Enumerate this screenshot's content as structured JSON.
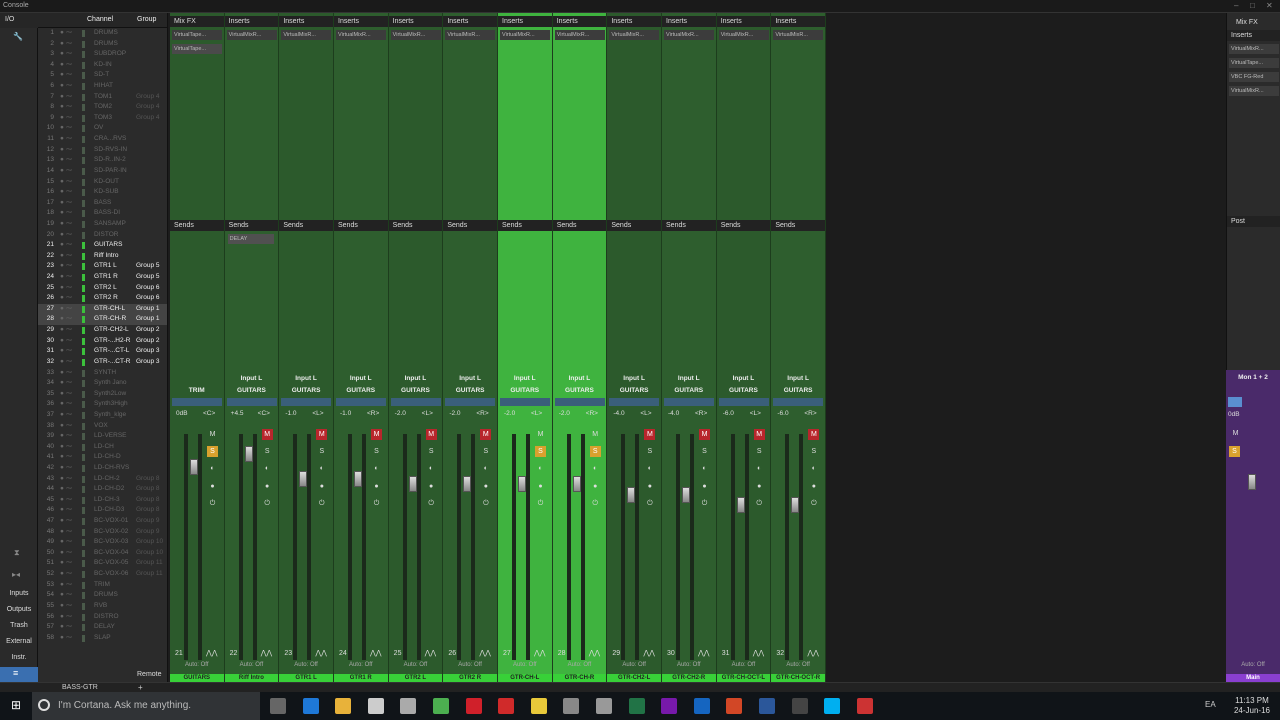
{
  "window": {
    "title": "Console"
  },
  "left_panel": {
    "io": "I/O",
    "items": [
      "Inputs",
      "Outputs",
      "Trash",
      "External",
      "Instr."
    ]
  },
  "channel_list": {
    "col_channel": "Channel",
    "col_group": "Group",
    "rows": [
      {
        "n": "1",
        "name": "DRUMS",
        "group": "",
        "active": false
      },
      {
        "n": "2",
        "name": "DRUMS",
        "group": "",
        "active": false
      },
      {
        "n": "3",
        "name": "SUBDROP",
        "group": "",
        "active": false
      },
      {
        "n": "4",
        "name": "KD-IN",
        "group": "",
        "active": false
      },
      {
        "n": "5",
        "name": "SD-T",
        "group": "",
        "active": false
      },
      {
        "n": "6",
        "name": "HIHAT",
        "group": "",
        "active": false
      },
      {
        "n": "7",
        "name": "TOM1",
        "group": "Group 4",
        "active": false
      },
      {
        "n": "8",
        "name": "TOM2",
        "group": "Group 4",
        "active": false
      },
      {
        "n": "9",
        "name": "TOM3",
        "group": "Group 4",
        "active": false
      },
      {
        "n": "10",
        "name": "OV",
        "group": "",
        "active": false
      },
      {
        "n": "11",
        "name": "CRA...RVS",
        "group": "",
        "active": false
      },
      {
        "n": "12",
        "name": "SD-RVS-IN",
        "group": "",
        "active": false
      },
      {
        "n": "13",
        "name": "SD-R..IN-2",
        "group": "",
        "active": false
      },
      {
        "n": "14",
        "name": "SD-PAR-IN",
        "group": "",
        "active": false
      },
      {
        "n": "15",
        "name": "KD-OUT",
        "group": "",
        "active": false
      },
      {
        "n": "16",
        "name": "KD-SUB",
        "group": "",
        "active": false
      },
      {
        "n": "17",
        "name": "BASS",
        "group": "",
        "active": false
      },
      {
        "n": "18",
        "name": "BASS-DI",
        "group": "",
        "active": false
      },
      {
        "n": "19",
        "name": "SANSAMP",
        "group": "",
        "active": false
      },
      {
        "n": "20",
        "name": "DISTOR",
        "group": "",
        "active": false
      },
      {
        "n": "21",
        "name": "GUITARS",
        "group": "",
        "active": true
      },
      {
        "n": "22",
        "name": "Riff Intro",
        "group": "",
        "active": true
      },
      {
        "n": "23",
        "name": "GTR1 L",
        "group": "Group 5",
        "active": true
      },
      {
        "n": "24",
        "name": "GTR1 R",
        "group": "Group 5",
        "active": true
      },
      {
        "n": "25",
        "name": "GTR2 L",
        "group": "Group 6",
        "active": true
      },
      {
        "n": "26",
        "name": "GTR2 R",
        "group": "Group 6",
        "active": true
      },
      {
        "n": "27",
        "name": "GTR-CH-L",
        "group": "Group 1",
        "active": true,
        "sel": true
      },
      {
        "n": "28",
        "name": "GTR-CH-R",
        "group": "Group 1",
        "active": true,
        "sel": true
      },
      {
        "n": "29",
        "name": "GTR-CH2-L",
        "group": "Group 2",
        "active": true
      },
      {
        "n": "30",
        "name": "GTR-...H2-R",
        "group": "Group 2",
        "active": true
      },
      {
        "n": "31",
        "name": "GTR-...CT-L",
        "group": "Group 3",
        "active": true
      },
      {
        "n": "32",
        "name": "GTR-...CT-R",
        "group": "Group 3",
        "active": true
      },
      {
        "n": "33",
        "name": "SYNTH",
        "group": "",
        "active": false
      },
      {
        "n": "34",
        "name": "Synth Jano",
        "group": "",
        "active": false
      },
      {
        "n": "35",
        "name": "Synth2Low",
        "group": "",
        "active": false
      },
      {
        "n": "36",
        "name": "Synth3High",
        "group": "",
        "active": false
      },
      {
        "n": "37",
        "name": "Synth_klge",
        "group": "",
        "active": false
      },
      {
        "n": "38",
        "name": "VOX",
        "group": "",
        "active": false
      },
      {
        "n": "39",
        "name": "LD-VERSE",
        "group": "",
        "active": false
      },
      {
        "n": "40",
        "name": "LD-CH",
        "group": "",
        "active": false
      },
      {
        "n": "41",
        "name": "LD-CH-D",
        "group": "",
        "active": false
      },
      {
        "n": "42",
        "name": "LD-CH-RVS",
        "group": "",
        "active": false
      },
      {
        "n": "43",
        "name": "LD-CH-2",
        "group": "Group 8",
        "active": false
      },
      {
        "n": "44",
        "name": "LD-CH-D2",
        "group": "Group 8",
        "active": false
      },
      {
        "n": "45",
        "name": "LD-CH-3",
        "group": "Group 8",
        "active": false
      },
      {
        "n": "46",
        "name": "LD-CH-D3",
        "group": "Group 8",
        "active": false
      },
      {
        "n": "47",
        "name": "BC-VOX-01",
        "group": "Group 9",
        "active": false
      },
      {
        "n": "48",
        "name": "BC-VOX-02",
        "group": "Group 9",
        "active": false
      },
      {
        "n": "49",
        "name": "BC-VOX-03",
        "group": "Group 10",
        "active": false
      },
      {
        "n": "50",
        "name": "BC-VOX-04",
        "group": "Group 10",
        "active": false
      },
      {
        "n": "51",
        "name": "BC-VOX-05",
        "group": "Group 11",
        "active": false
      },
      {
        "n": "52",
        "name": "BC-VOX-06",
        "group": "Group 11",
        "active": false
      },
      {
        "n": "53",
        "name": "TRIM",
        "group": "",
        "active": false
      },
      {
        "n": "54",
        "name": "DRUMS",
        "group": "",
        "active": false
      },
      {
        "n": "55",
        "name": "RVB",
        "group": "",
        "active": false
      },
      {
        "n": "56",
        "name": "DISTRO",
        "group": "",
        "active": false
      },
      {
        "n": "57",
        "name": "DELAY",
        "group": "",
        "active": false
      },
      {
        "n": "58",
        "name": "SLAP",
        "group": "",
        "active": false
      }
    ]
  },
  "mixer": {
    "mixfx_label": "Mix FX",
    "inserts_label": "Inserts",
    "sends_label": "Sends",
    "auto_label": "Auto: Off",
    "strips": [
      {
        "num": "21",
        "input": "",
        "group": "TRIM",
        "vol": "0dB",
        "pan": "<C>",
        "insert": "VirtualTape...",
        "name": "GUITARS",
        "style": "dark",
        "send": "",
        "mute": false,
        "solo": true
      },
      {
        "num": "22",
        "input": "Input L",
        "group": "GUITARS",
        "vol": "+4.5",
        "pan": "<C>",
        "insert": "VirtualMixR...",
        "name": "Riff Intro",
        "style": "mid",
        "send": "DELAY",
        "mute": true,
        "solo": false
      },
      {
        "num": "23",
        "input": "Input L",
        "group": "GUITARS",
        "vol": "-1.0",
        "pan": "<L>",
        "insert": "VirtualMixR...",
        "name": "GTR1 L",
        "style": "dark",
        "send": "",
        "mute": true,
        "solo": false
      },
      {
        "num": "24",
        "input": "Input L",
        "group": "GUITARS",
        "vol": "-1.0",
        "pan": "<R>",
        "insert": "VirtualMixR...",
        "name": "GTR1 R",
        "style": "mid",
        "send": "",
        "mute": true,
        "solo": false
      },
      {
        "num": "25",
        "input": "Input L",
        "group": "GUITARS",
        "vol": "-2.0",
        "pan": "<L>",
        "insert": "VirtualMixR...",
        "name": "GTR2 L",
        "style": "dark",
        "send": "",
        "mute": true,
        "solo": false
      },
      {
        "num": "26",
        "input": "Input L",
        "group": "GUITARS",
        "vol": "-2.0",
        "pan": "<R>",
        "insert": "VirtualMixR...",
        "name": "GTR2 R",
        "style": "mid",
        "send": "",
        "mute": true,
        "solo": false
      },
      {
        "num": "27",
        "input": "Input L",
        "group": "GUITARS",
        "vol": "-2.0",
        "pan": "<L>",
        "insert": "VirtualMixR...",
        "name": "GTR-CH-L",
        "style": "lit",
        "send": "",
        "mute": false,
        "solo": true
      },
      {
        "num": "28",
        "input": "Input L",
        "group": "GUITARS",
        "vol": "-2.0",
        "pan": "<R>",
        "insert": "VirtualMixR...",
        "name": "GTR-CH-R",
        "style": "lit",
        "send": "",
        "mute": false,
        "solo": true
      },
      {
        "num": "29",
        "input": "Input L",
        "group": "GUITARS",
        "vol": "-4.0",
        "pan": "<L>",
        "insert": "VirtualMixR...",
        "name": "GTR-CH2-L",
        "style": "dark",
        "send": "",
        "mute": true,
        "solo": false
      },
      {
        "num": "30",
        "input": "Input L",
        "group": "GUITARS",
        "vol": "-4.0",
        "pan": "<R>",
        "insert": "VirtualMixR...",
        "name": "GTR-CH2-R",
        "style": "mid",
        "send": "",
        "mute": true,
        "solo": false
      },
      {
        "num": "31",
        "input": "Input L",
        "group": "GUITARS",
        "vol": "-6.0",
        "pan": "<L>",
        "insert": "VirtualMixR...",
        "name": "GTR-CH-OCT-L",
        "style": "dark",
        "send": "",
        "mute": true,
        "solo": false
      },
      {
        "num": "32",
        "input": "Input L",
        "group": "GUITARS",
        "vol": "-6.0",
        "pan": "<R>",
        "insert": "VirtualMixR...",
        "name": "GTR-CH-OCT-R",
        "style": "mid",
        "send": "",
        "mute": true,
        "solo": false
      }
    ]
  },
  "right_panel": {
    "mixfx": "Mix FX",
    "inserts": "Inserts",
    "plugins": [
      "VirtualMixR...",
      "VirtualTape...",
      "VBC FG-Red",
      "VirtualMixR..."
    ],
    "post": "Post",
    "main_input": "Mon 1 + 2",
    "main_vol": "0dB",
    "main_name": "Main"
  },
  "bottom": {
    "label": "BASS-GTR",
    "remote": "Remote"
  },
  "taskbar": {
    "cortana": "I'm Cortana. Ask me anything.",
    "lang": "EA",
    "time": "11:13 PM",
    "date": "24-Jun-16"
  }
}
